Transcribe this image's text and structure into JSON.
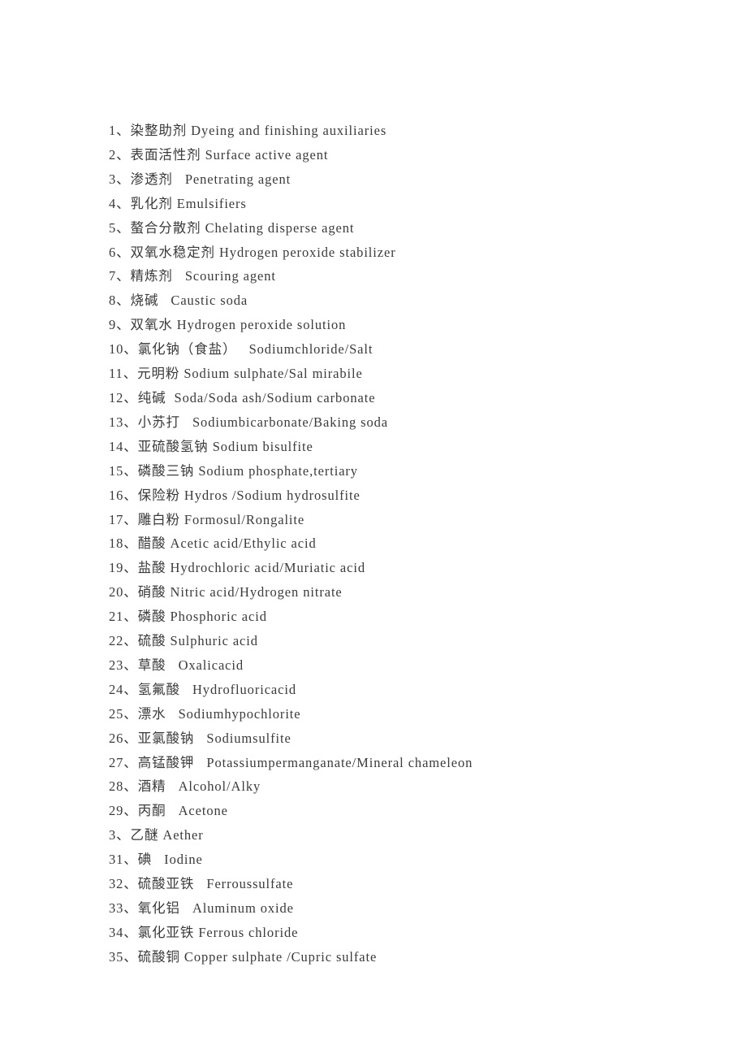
{
  "document": {
    "lines": [
      {
        "text": "1、染整助剂 Dyeing and finishing auxiliaries"
      },
      {
        "text": "2、表面活性剂 Surface active agent"
      },
      {
        "text": "3、渗透剂   Penetrating agent"
      },
      {
        "text": "4、乳化剂 Emulsifiers"
      },
      {
        "text": "5、螯合分散剂 Chelating disperse agent"
      },
      {
        "text": "6、双氧水稳定剂 Hydrogen peroxide stabilizer"
      },
      {
        "text": "7、精炼剂   Scouring agent"
      },
      {
        "text": "8、烧碱   Caustic soda"
      },
      {
        "text": "9、双氧水 Hydrogen peroxide solution"
      },
      {
        "text": "10、氯化钠（食盐）   Sodiumchloride/Salt"
      },
      {
        "text": "11、元明粉 Sodium sulphate/Sal mirabile"
      },
      {
        "text": "12、纯碱  Soda/Soda ash/Sodium carbonate"
      },
      {
        "text": "13、小苏打   Sodiumbicarbonate/Baking soda"
      },
      {
        "text": "14、亚硫酸氢钠 Sodium bisulfite"
      },
      {
        "text": "15、磷酸三钠 Sodium phosphate,tertiary"
      },
      {
        "text": "16、保险粉 Hydros /Sodium hydrosulfite"
      },
      {
        "text": "17、雕白粉 Formosul/Rongalite"
      },
      {
        "text": "18、醋酸 Acetic acid/Ethylic acid"
      },
      {
        "text": "19、盐酸 Hydrochloric acid/Muriatic acid"
      },
      {
        "text": "20、硝酸 Nitric acid/Hydrogen nitrate"
      },
      {
        "text": "21、磷酸 Phosphoric acid"
      },
      {
        "text": "22、硫酸 Sulphuric acid"
      },
      {
        "text": "23、草酸   Oxalicacid"
      },
      {
        "text": "24、氢氟酸   Hydrofluoricacid"
      },
      {
        "text": "25、漂水   Sodiumhypochlorite"
      },
      {
        "text": "26、亚氯酸钠   Sodiumsulfite"
      },
      {
        "text": "27、高锰酸钾   Potassiumpermanganate/Mineral chameleon"
      },
      {
        "text": "28、酒精   Alcohol/Alky"
      },
      {
        "text": "29、丙酮   Acetone"
      },
      {
        "text": "3、乙醚 Aether"
      },
      {
        "text": "31、碘   Iodine"
      },
      {
        "text": "32、硫酸亚铁   Ferroussulfate"
      },
      {
        "text": "33、氧化铝   Aluminum oxide"
      },
      {
        "text": "34、氯化亚铁 Ferrous chloride"
      },
      {
        "text": "35、硫酸铜 Copper sulphate /Cupric sulfate"
      }
    ],
    "text_color": "#3b3b3b",
    "background_color": "#ffffff"
  }
}
